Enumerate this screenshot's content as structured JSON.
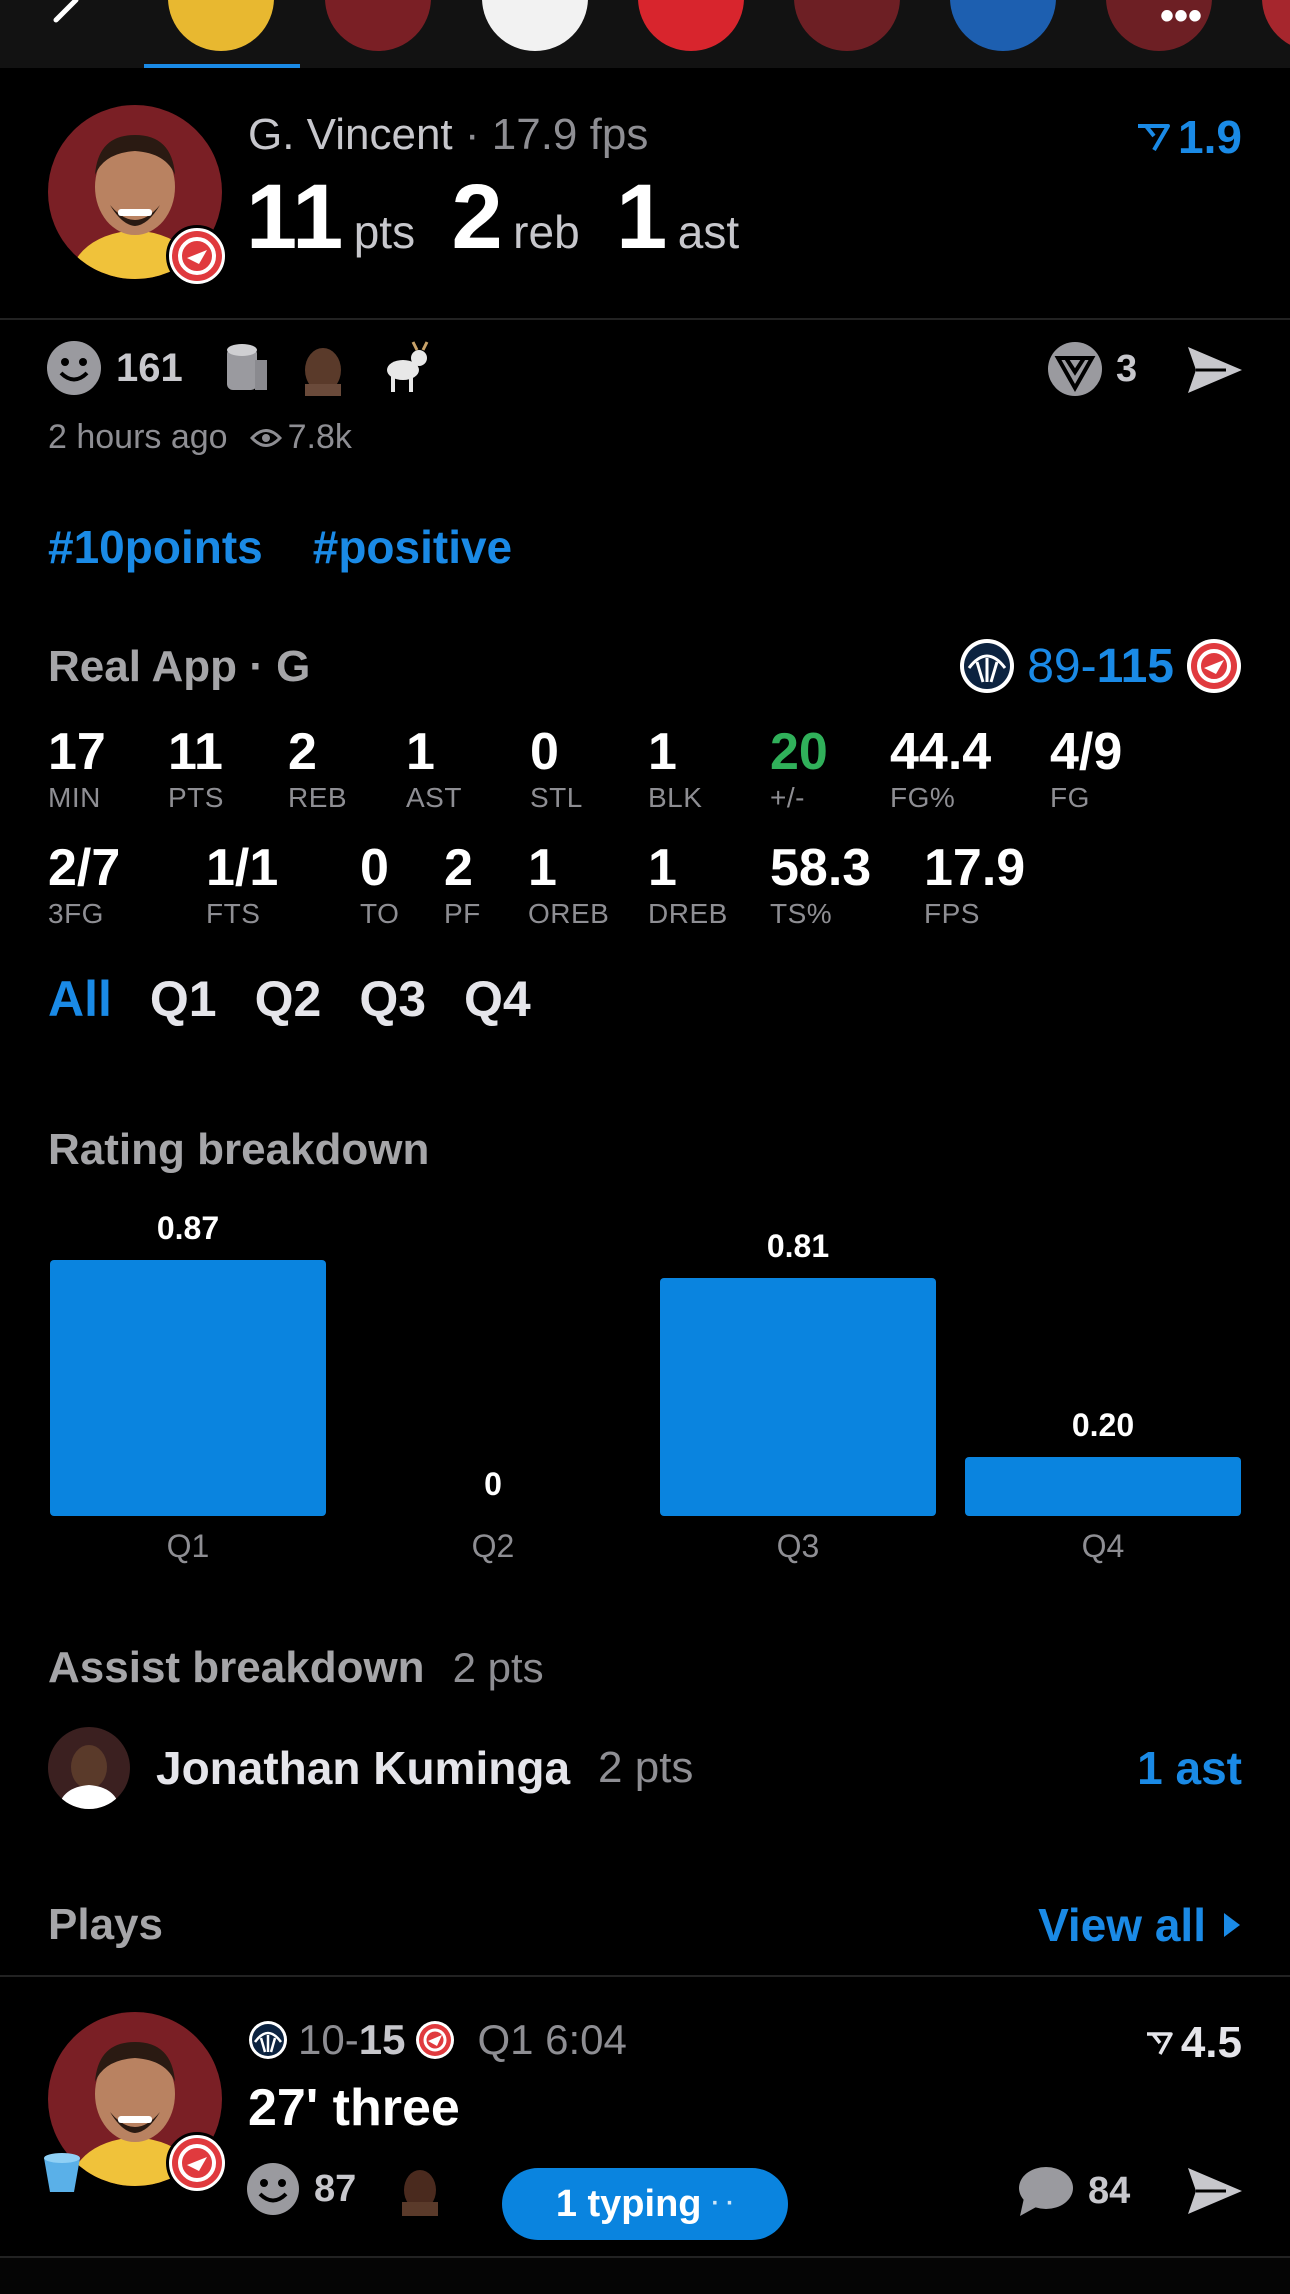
{
  "player": {
    "name": "G. Vincent",
    "fps_label": "17.9 fps",
    "pts": "11",
    "pts_label": "pts",
    "reb": "2",
    "reb_label": "reb",
    "ast": "1",
    "ast_label": "ast",
    "rating": "1.9"
  },
  "reactions": {
    "count": "161",
    "shares": "3"
  },
  "meta": {
    "time": "2 hours ago",
    "views": "7.8k"
  },
  "tags": [
    "#10points",
    "#positive"
  ],
  "game": {
    "source": "Real App · G",
    "away_score": "89",
    "dash": "-",
    "home_score": "115"
  },
  "stats_row1": [
    {
      "value": "17",
      "label": "MIN"
    },
    {
      "value": "11",
      "label": "PTS"
    },
    {
      "value": "2",
      "label": "REB"
    },
    {
      "value": "1",
      "label": "AST"
    },
    {
      "value": "0",
      "label": "STL"
    },
    {
      "value": "1",
      "label": "BLK"
    },
    {
      "value": "20",
      "label": "+/-"
    },
    {
      "value": "44.4",
      "label": "FG%"
    },
    {
      "value": "4/9",
      "label": "FG"
    }
  ],
  "stats_row2": [
    {
      "value": "2/7",
      "label": "3FG"
    },
    {
      "value": "1/1",
      "label": "FTS"
    },
    {
      "value": "0",
      "label": "TO"
    },
    {
      "value": "2",
      "label": "PF"
    },
    {
      "value": "1",
      "label": "OREB"
    },
    {
      "value": "1",
      "label": "DREB"
    },
    {
      "value": "58.3",
      "label": "TS%"
    },
    {
      "value": "17.9",
      "label": "FPS"
    }
  ],
  "quarter_tabs": [
    "All",
    "Q1",
    "Q2",
    "Q3",
    "Q4"
  ],
  "rating_breakdown": {
    "title": "Rating breakdown"
  },
  "chart_data": {
    "type": "bar",
    "categories": [
      "Q1",
      "Q2",
      "Q3",
      "Q4"
    ],
    "values": [
      0.87,
      0,
      0.81,
      0.2
    ],
    "value_labels": [
      "0.87",
      "0",
      "0.81",
      "0.20"
    ],
    "ylim": [
      0,
      0.87
    ],
    "color": "#0a84df"
  },
  "assist": {
    "title": "Assist breakdown",
    "title_pts": "2 pts",
    "player": "Jonathan Kuminga",
    "player_pts": "2 pts",
    "ast": "1 ast"
  },
  "plays": {
    "title": "Plays",
    "view_all": "View all"
  },
  "play": {
    "away_score": "10",
    "dash": "-",
    "home_score": "15",
    "clock": "Q1 6:04",
    "rating": "4.5",
    "desc": "27' three",
    "reactions": "87",
    "comments": "84",
    "typing": "1 typing"
  },
  "colors": {
    "accent": "#1a8ae6",
    "positive": "#30b05a"
  }
}
